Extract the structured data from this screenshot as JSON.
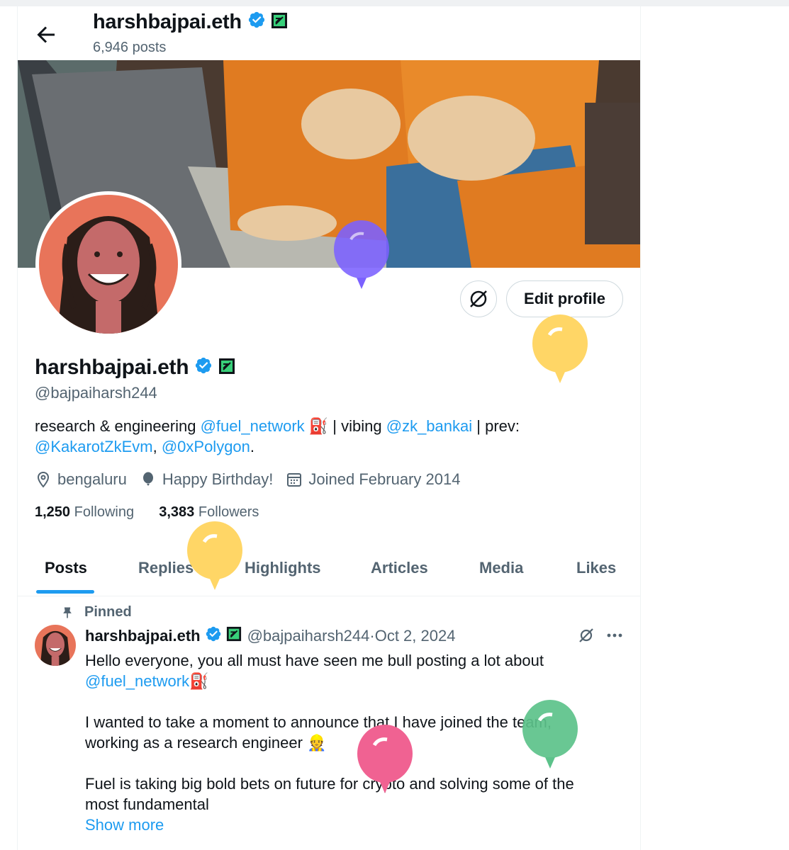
{
  "header": {
    "name": "harshbajpai.eth",
    "posts_count": "6,946 posts"
  },
  "profile": {
    "name": "harshbajpai.eth",
    "handle": "@bajpaiharsh244",
    "edit_button": "Edit profile",
    "bio": {
      "t1": "research & engineering ",
      "l1": "@fuel_network",
      "t2": " | vibing ",
      "l2": "@zk_bankai",
      "t3": " | prev:",
      "l3": "@KakarotZkEvm",
      "t4": ", ",
      "l4": "@0xPolygon",
      "t5": "."
    },
    "location": "bengaluru",
    "birthday": "Happy Birthday!",
    "joined": "Joined February 2014",
    "following_count": "1,250",
    "following_label": "Following",
    "followers_count": "3,383",
    "followers_label": "Followers"
  },
  "tabs": [
    "Posts",
    "Replies",
    "Highlights",
    "Articles",
    "Media",
    "Likes"
  ],
  "pinned_tweet": {
    "pinned_label": "Pinned",
    "author_name": "harshbajpai.eth",
    "author_handle": "@bajpaiharsh244",
    "date_sep": " · ",
    "date": "Oct 2, 2024",
    "line1": "Hello everyone, you all must have seen me bull posting a lot about",
    "mention": "@fuel_network",
    "line2": "I wanted to take a moment to announce that I have joined the team,",
    "line3": "working as a research engineer",
    "line4": "Fuel is taking big bold bets on future for crypto and solving some of the",
    "line5": "most fundamental",
    "show_more": "Show more"
  },
  "colors": {
    "accent": "#1d9bf0",
    "balloon_purple": "#7b61ff",
    "balloon_yellow": "#ffd666",
    "balloon_pink": "#f06292",
    "balloon_green": "#5cc28a"
  },
  "icons": [
    "back-arrow-icon",
    "verified-badge-icon",
    "affiliate-badge-icon",
    "grok-icon",
    "location-icon",
    "balloon-icon",
    "calendar-icon",
    "pin-icon",
    "more-icon"
  ]
}
